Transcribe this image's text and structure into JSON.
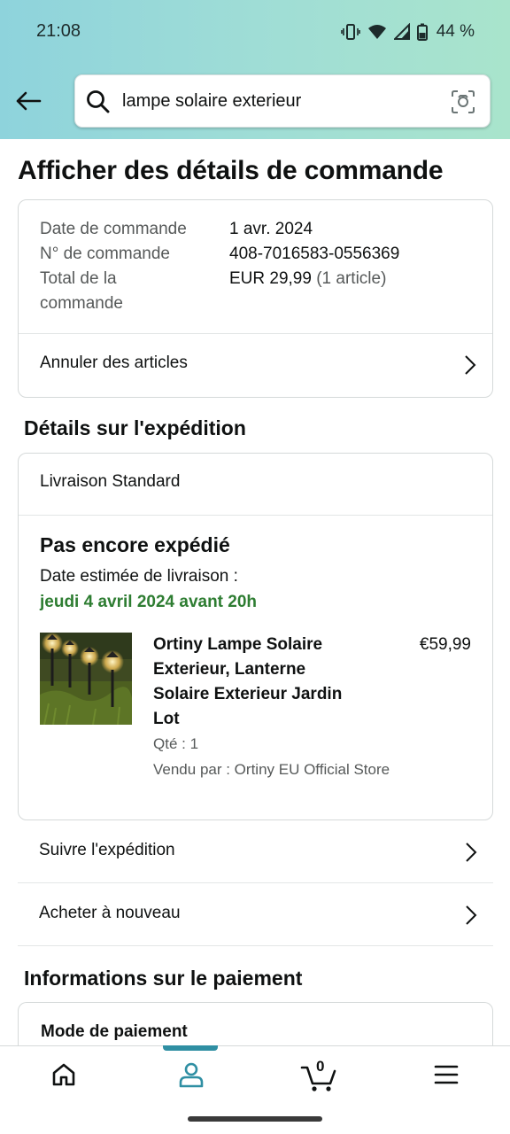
{
  "status_bar": {
    "time": "21:08",
    "battery": "44 %"
  },
  "search": {
    "query": "lampe solaire exterieur"
  },
  "page_title": "Afficher des détails de commande",
  "order_summary": {
    "date_label": "Date de commande",
    "date_value": "1 avr. 2024",
    "number_label": "N° de commande",
    "number_value": "408-7016583-0556369",
    "total_label_line1": "Total de la",
    "total_label_line2": "commande",
    "total_value": "EUR 29,99",
    "total_items": "(1 article)",
    "cancel_label": "Annuler des articles"
  },
  "shipping": {
    "section_title": "Détails sur l'expédition",
    "method": "Livraison Standard",
    "status": "Pas encore expédié",
    "estimate_label": "Date estimée de livraison :",
    "estimate_date": "jeudi 4 avril 2024 avant 20h",
    "estimate_color": "#2e7d32",
    "item": {
      "name": "Ortiny Lampe Solaire Exterieur, Lanterne Solaire Exterieur Jardin Lot",
      "price": "€59,99",
      "qty": "Qté : 1",
      "seller": "Vendu par : Ortiny EU Official Store"
    },
    "track_label": "Suivre l'expédition",
    "buy_again_label": "Acheter à nouveau"
  },
  "payment": {
    "section_title": "Informations sur le paiement",
    "mode_label": "Mode de paiement"
  },
  "bottom_nav": {
    "items": [
      "home-icon",
      "account-icon",
      "cart-icon",
      "menu-icon"
    ],
    "cart_count": "0",
    "active": "account",
    "accent_color": "#2f8fa3"
  }
}
